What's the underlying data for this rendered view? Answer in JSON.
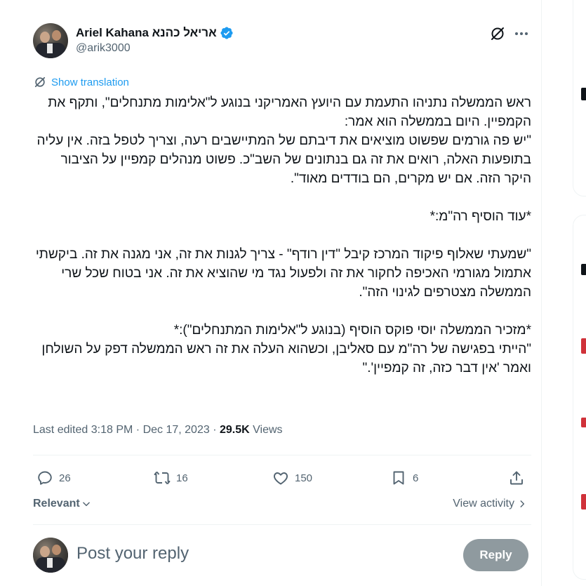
{
  "author": {
    "name": "Ariel Kahana אריאל כהנא",
    "handle": "@arik3000",
    "verified": true,
    "verified_color": "#1d9bf0"
  },
  "header_actions": {
    "grok_icon": "grok-slash-circle-icon",
    "more_icon": "more-dots-icon"
  },
  "translation": {
    "label": "Show translation",
    "color": "#1d9bf0"
  },
  "tweet": {
    "text": "ראש הממשלה נתניהו התעמת עם היועץ האמריקני בנוגע ל\"אלימות מתנחלים\", ותקף את הקמפיין. היום בממשלה הוא אמר:\n\"יש פה גורמים שפשוט מוציאים את דיבתם של המתיישבים רעה, וצריך לטפל בזה. אין עליה בתופעות האלה, רואים את זה גם בנתונים של השב\"כ. פשוט מנהלים קמפיין על הציבור היקר הזה. אם יש מקרים, הם בודדים מאוד\".\n\n*עוד הוסיף רה\"מ:*\n\n\"שמעתי שאלוף פיקוד המרכז קיבל \"דין רודף\" - צריך לגנות את זה, אני מגנה את זה. ביקשתי אתמול מגורמי האכיפה לחקור את זה ולפעול נגד מי שהוציא את זה. אני בטוח שכל שרי הממשלה מצטרפים לגינוי הזה\".\n\n*מזכיר הממשלה יוסי פוקס הוסיף (בנוגע ל\"אלימות המתנחלים\"):*\n\"הייתי בפגישה של רה\"מ עם סאליבן, וכשהוא העלה את זה ראש הממשלה דפק על השולחן ואמר 'אין דבר כזה, זה קמפיין'.\""
  },
  "meta": {
    "edited_label": "Last edited",
    "time": "3:18 PM",
    "separator": "·",
    "date": "Dec 17, 2023",
    "views_count": "29.5K",
    "views_label": "Views"
  },
  "actions": {
    "replies": "26",
    "reposts": "16",
    "likes": "150",
    "bookmarks": "6"
  },
  "sort": {
    "relevant_label": "Relevant",
    "view_activity_label": "View activity"
  },
  "reply": {
    "placeholder": "Post your reply",
    "button_label": "Reply",
    "button_color": "#8f9a9f"
  },
  "colors": {
    "text_primary": "#0f1419",
    "text_secondary": "#536471",
    "border": "#eff3f4"
  }
}
